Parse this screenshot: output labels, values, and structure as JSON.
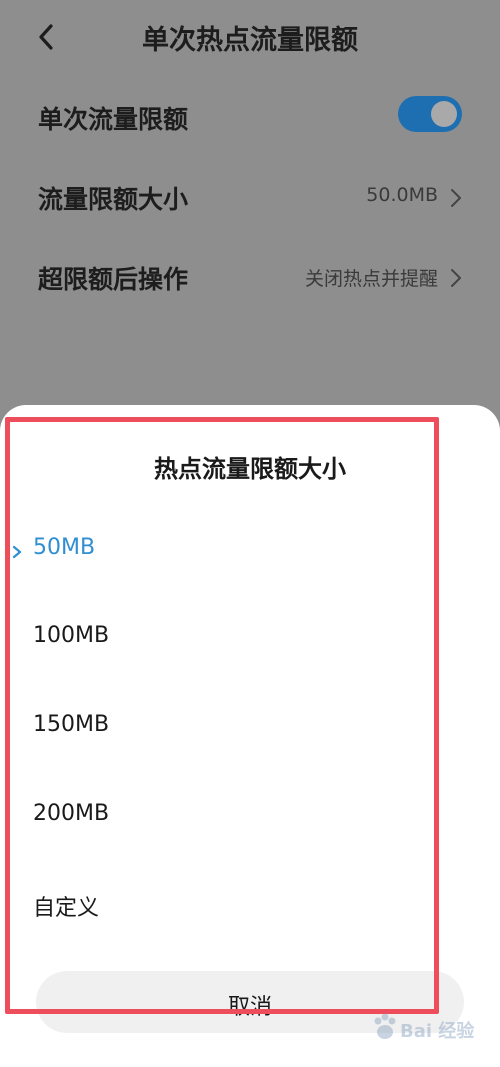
{
  "header": {
    "title": "单次热点流量限额"
  },
  "settings": {
    "single_limit": {
      "label": "单次流量限额",
      "enabled": true
    },
    "limit_size": {
      "label": "流量限额大小",
      "value": "50.0MB"
    },
    "over_action": {
      "label": "超限额后操作",
      "value": "关闭热点并提醒"
    }
  },
  "sheet": {
    "title": "热点流量限额大小",
    "options": [
      "50MB",
      "100MB",
      "150MB",
      "200MB",
      "自定义"
    ],
    "selected_index": 0,
    "cancel_label": "取消"
  },
  "watermark": {
    "text": "Bai 经验"
  },
  "colors": {
    "accent": "#2f8fd1",
    "toggle_on": "#1e6fb1",
    "highlight": "#ee4d5b",
    "dim_background": "#8e8e8e"
  }
}
